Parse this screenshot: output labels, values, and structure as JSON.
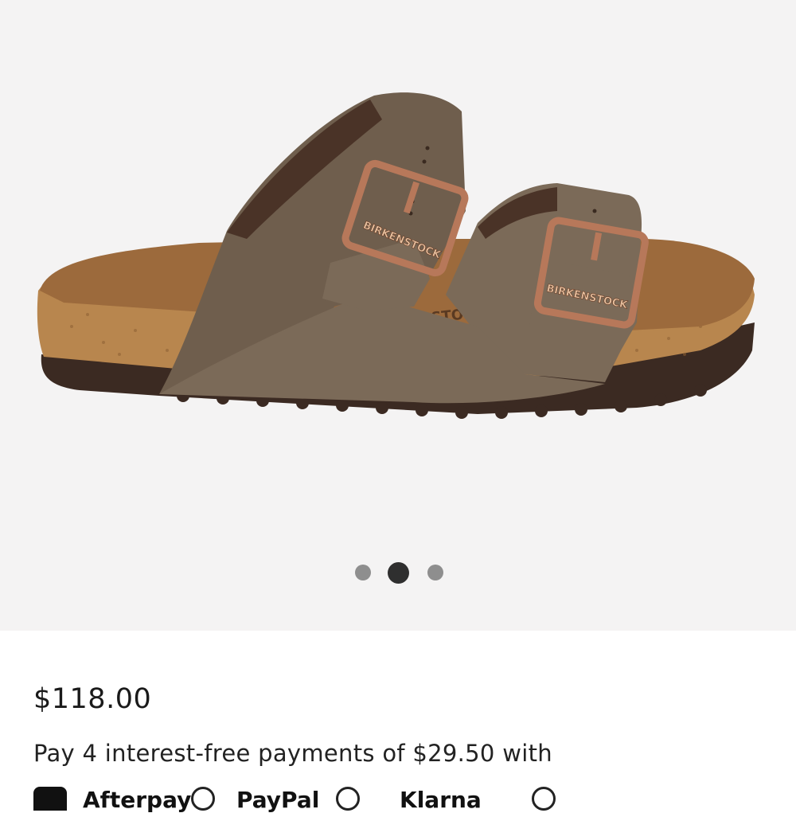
{
  "product": {
    "image_alt": "Birkenstock two-strap sandal in brown with copper buckles",
    "buckle_text": "BIRKENSTOCK",
    "footbed_text": "STOCK"
  },
  "carousel": {
    "slide_count": 3,
    "active_index": 1
  },
  "pricing": {
    "price": "$118.00",
    "installment_text": "Pay 4 interest-free payments of $29.50 with"
  },
  "payment_providers": [
    {
      "name": "Afterpay",
      "icon": "afterpay-logo"
    },
    {
      "name": "PayPal",
      "icon": "paypal-logo"
    },
    {
      "name": "Klarna",
      "icon": "klarna-logo"
    }
  ],
  "colors": {
    "gallery_bg": "#f4f3f3",
    "strap": "#7b6a58",
    "cork": "#b8864e",
    "sole": "#3b2a22",
    "buckle": "#b7785a",
    "dot_active": "#2f2f2f",
    "dot_inactive": "#8e8e8e"
  }
}
